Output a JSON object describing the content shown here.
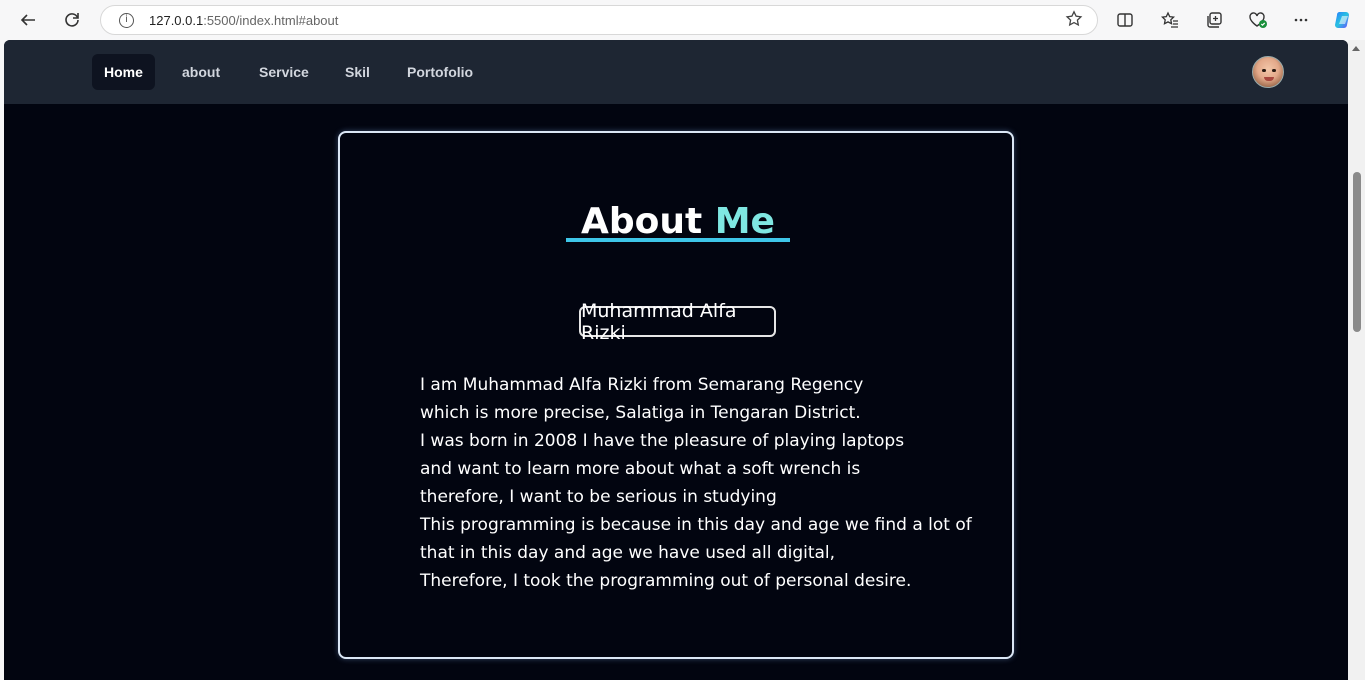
{
  "browser": {
    "url_host": "127.0.0.1",
    "url_rest": ":5500/index.html#about",
    "icons": [
      "back-icon",
      "reload-icon",
      "info-icon",
      "star-icon",
      "split-view-icon",
      "favorites-icon",
      "collections-icon",
      "health-icon",
      "more-icon",
      "copilot-icon"
    ]
  },
  "nav": {
    "items": [
      "Home",
      "about",
      "Service",
      "Skil",
      "Portofolio"
    ],
    "active": "Home"
  },
  "about": {
    "title_main": "About ",
    "title_accent": "Me",
    "name": "Muhammad Alfa Rizki",
    "bio": [
      "I am Muhammad Alfa Rizki from Semarang Regency",
      "which is more precise, Salatiga in Tengaran District.",
      "I was born in 2008 I have the pleasure of playing laptops",
      "and want to learn more about what a soft wrench is",
      "therefore, I want to be serious in studying",
      "This programming is because in this day and age we find a lot of",
      "that in this day and age we have used all digital,",
      "Therefore, I took the programming out of personal desire."
    ]
  },
  "colors": {
    "page_bg": "#020510",
    "navbar_bg": "#1e2633",
    "accent": "#7fe7e2",
    "underline": "#3ec6e8"
  }
}
